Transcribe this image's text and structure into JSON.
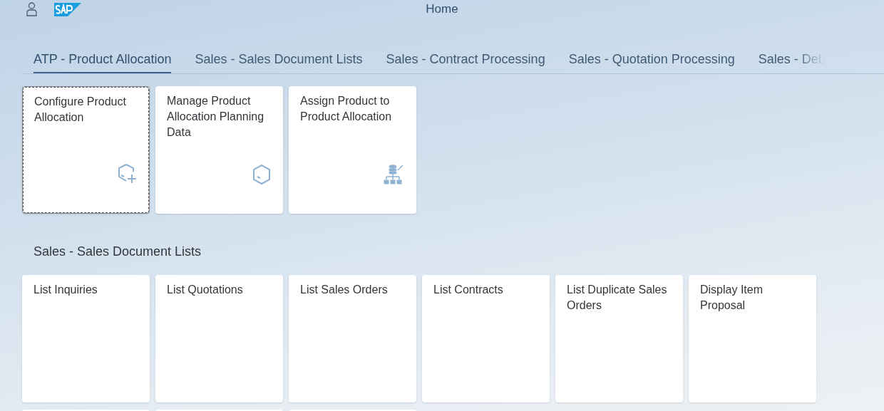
{
  "header": {
    "title": "Home"
  },
  "tabs": [
    {
      "label": "ATP - Product Allocation",
      "selected": true
    },
    {
      "label": "Sales - Sales Document Lists",
      "selected": false
    },
    {
      "label": "Sales - Contract Processing",
      "selected": false
    },
    {
      "label": "Sales - Quotation Processing",
      "selected": false
    },
    {
      "label": "Sales - Deb",
      "selected": false,
      "faded": true
    }
  ],
  "groups": [
    {
      "tiles": [
        {
          "title": "Configure Product Allocation",
          "kind": "cube-plus",
          "selected": true
        },
        {
          "title": "Manage Product Allocation Planning Data",
          "kind": "cube",
          "selected": false
        },
        {
          "title": "Assign Product to Product Allocation",
          "kind": "hierarchy",
          "selected": false
        }
      ]
    },
    {
      "title": "Sales - Sales Document Lists",
      "tiles": [
        {
          "title": "List Inquiries",
          "selected": false
        },
        {
          "title": "List Quotations",
          "selected": false
        },
        {
          "title": "List Sales Orders",
          "selected": false
        },
        {
          "title": "List Contracts",
          "selected": false
        },
        {
          "title": "List Duplicate Sales Orders",
          "selected": false
        },
        {
          "title": "Display Item Proposal",
          "selected": false
        }
      ]
    }
  ],
  "next_row_tiles": [
    {
      "kind": "tile"
    },
    {
      "kind": "tile"
    },
    {
      "kind": "tile"
    }
  ]
}
